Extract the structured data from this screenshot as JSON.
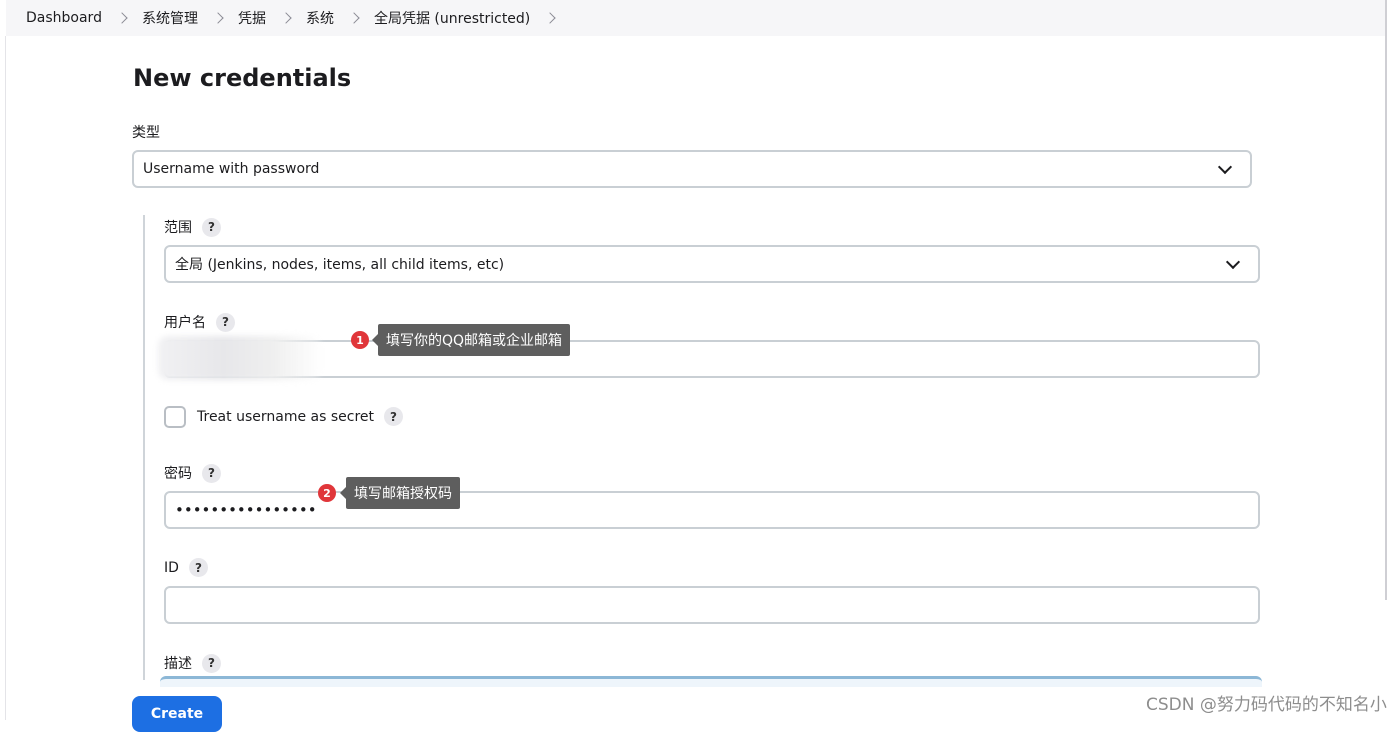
{
  "breadcrumb": {
    "items": [
      "Dashboard",
      "系统管理",
      "凭据",
      "系统",
      "全局凭据 (unrestricted)"
    ]
  },
  "page": {
    "title": "New credentials"
  },
  "form": {
    "kind": {
      "label": "类型",
      "value": "Username with password"
    },
    "scope": {
      "label": "范围",
      "value": "全局 (Jenkins, nodes, items, all child items, etc)"
    },
    "username": {
      "label": "用户名",
      "value": ""
    },
    "treat_secret": {
      "label": "Treat username as secret",
      "checked": false
    },
    "password": {
      "label": "密码",
      "value": "••••••••••••••••"
    },
    "id": {
      "label": "ID",
      "value": ""
    },
    "description": {
      "label": "描述"
    },
    "help_symbol": "?"
  },
  "annotations": [
    {
      "number": "1",
      "text": "填写你的QQ邮箱或企业邮箱"
    },
    {
      "number": "2",
      "text": "填写邮箱授权码"
    }
  ],
  "buttons": {
    "create": "Create"
  },
  "watermark": "CSDN @努力码代码的不知名小",
  "colors": {
    "primary_button": "#1d6fe3",
    "badge": "#e0363a",
    "tooltip": "#5e5e5e"
  }
}
